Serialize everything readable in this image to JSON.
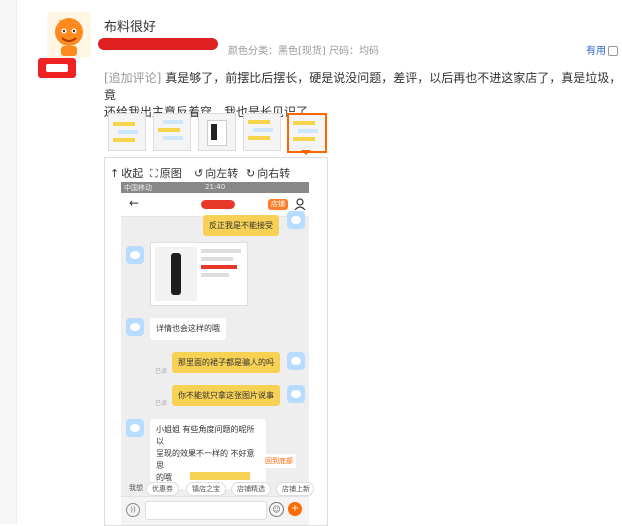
{
  "review": {
    "title": "布料很好",
    "spec": "颜色分类：黑色[现货]   尺码：均码",
    "useful_label": "有用",
    "append_tag": "[追加评论]",
    "append_line1": "真是够了，前摆比后摆长，硬是说没问题，差评，以后再也不进这家店了，真是垃圾，竟",
    "append_line2": "还给我出主意反着穿，我也是长见识了"
  },
  "viewer": {
    "toolbar": [
      {
        "icon": "collapse-icon",
        "glyph": "↑",
        "label": "收起"
      },
      {
        "icon": "fullscreen-icon",
        "glyph": "⛶",
        "label": "原图"
      },
      {
        "icon": "rotate-left-icon",
        "glyph": "↺",
        "label": "向左转"
      },
      {
        "icon": "rotate-right-icon",
        "glyph": "↻",
        "label": "向右转"
      }
    ]
  },
  "phone": {
    "status_left": "中国移动",
    "status_time": "21:40",
    "nav_badge": "店铺",
    "messages": {
      "m1": "反正我是不能接受",
      "m2": "详情也会这样的哦",
      "m3": "那里面的裙子都是骗人的吗",
      "m4": "你不能就只拿这张图片说事",
      "m5_line1": "小姐姐 有些角度问题的呢所以",
      "m5_line2": "呈现的效果不一样的 不好意思",
      "m5_line3": "的哦",
      "read": "已读"
    },
    "float_link": "回到底部",
    "chips": [
      "我想",
      "优惠券",
      "镇店之宝",
      "店铺精选",
      "店铺上新"
    ]
  },
  "colors": {
    "accent": "#ff6600",
    "redact": "#e02020",
    "bubble_yellow": "#f7d154",
    "avatar_blue": "#b8dcff"
  }
}
